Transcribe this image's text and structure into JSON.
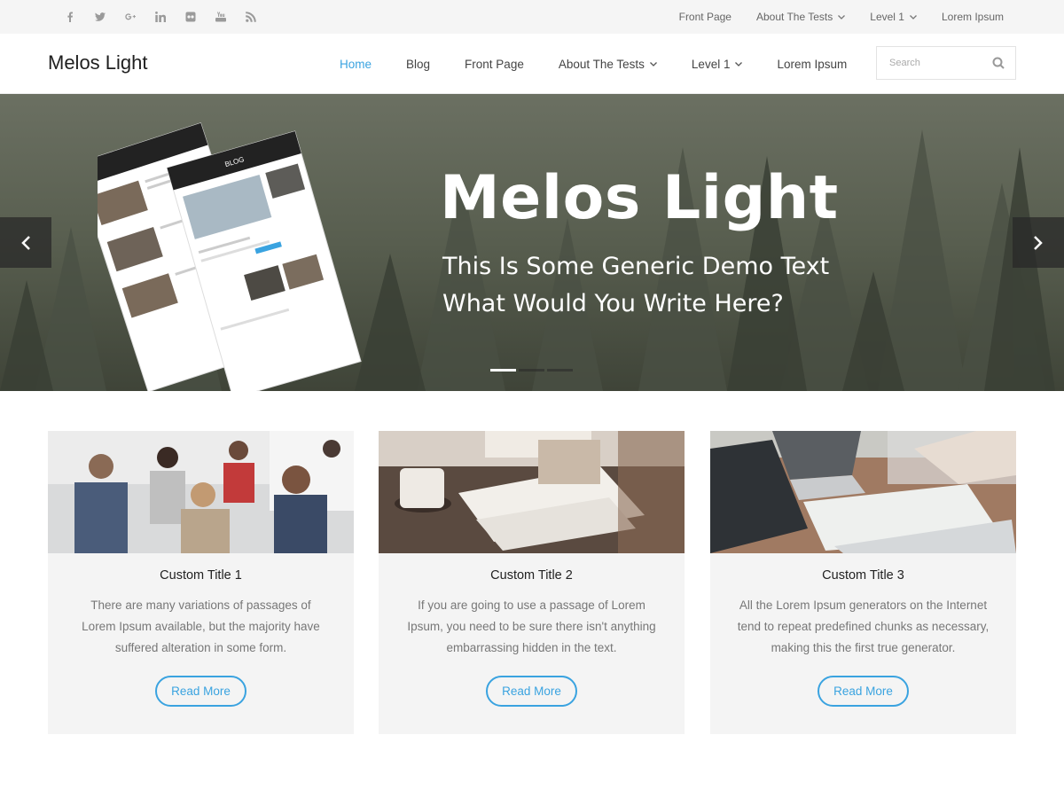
{
  "topbar": {
    "social_icons": [
      "facebook-icon",
      "twitter-icon",
      "google-plus-icon",
      "linkedin-icon",
      "flickr-icon",
      "youtube-icon",
      "rss-icon"
    ],
    "menu": [
      {
        "label": "Front Page",
        "has_dropdown": false
      },
      {
        "label": "About The Tests",
        "has_dropdown": true
      },
      {
        "label": "Level 1",
        "has_dropdown": true
      },
      {
        "label": "Lorem Ipsum",
        "has_dropdown": false
      }
    ]
  },
  "header": {
    "site_title": "Melos Light",
    "nav": [
      {
        "label": "Home",
        "active": true,
        "has_dropdown": false
      },
      {
        "label": "Blog",
        "active": false,
        "has_dropdown": false
      },
      {
        "label": "Front Page",
        "active": false,
        "has_dropdown": false
      },
      {
        "label": "About The Tests",
        "active": false,
        "has_dropdown": true
      },
      {
        "label": "Level 1",
        "active": false,
        "has_dropdown": true
      },
      {
        "label": "Lorem Ipsum",
        "active": false,
        "has_dropdown": false
      }
    ],
    "search_placeholder": "Search"
  },
  "hero": {
    "title": "Melos Light",
    "subtitle_line1": "This Is Some Generic Demo Text",
    "subtitle_line2": "What Would You Write Here?",
    "mockup_label": "BLOG",
    "slides_count": 3,
    "active_slide": 1
  },
  "cards": [
    {
      "title": "Custom Title 1",
      "text": "There are many variations of passages of Lorem Ipsum available, but the majority have suffered alteration in some form.",
      "button": "Read More"
    },
    {
      "title": "Custom Title 2",
      "text": "If you are going to use a passage of Lorem Ipsum, you need to be sure there isn't anything embarrassing hidden in the text.",
      "button": "Read More"
    },
    {
      "title": "Custom Title 3",
      "text": "All the Lorem Ipsum generators on the Internet tend to repeat predefined chunks as necessary, making this the first true generator.",
      "button": "Read More"
    }
  ],
  "colors": {
    "accent": "#3aa3e0",
    "topbar_bg": "#f5f5f5",
    "card_bg": "#f4f4f4"
  }
}
